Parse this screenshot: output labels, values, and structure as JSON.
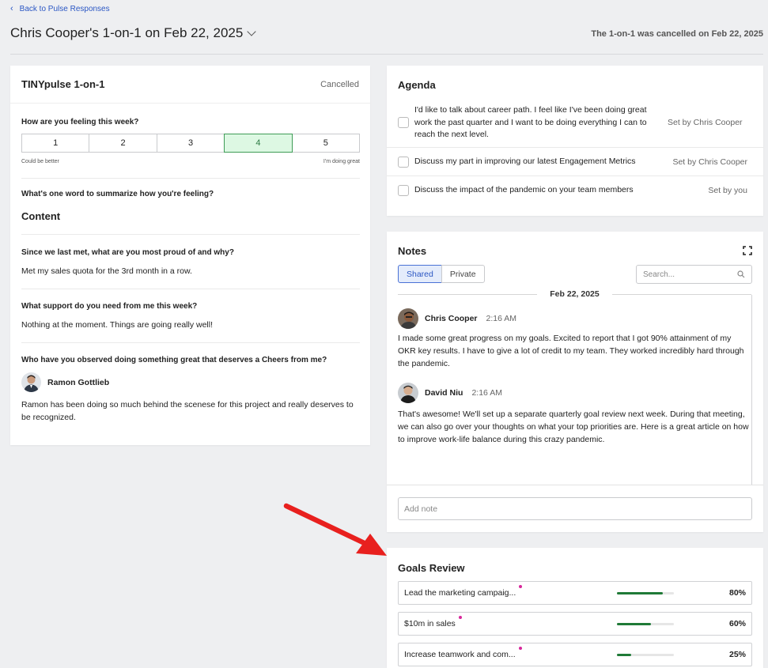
{
  "nav": {
    "back_label": "Back to Pulse Responses"
  },
  "header": {
    "title": "Chris Cooper's 1-on-1 on Feb 22, 2025",
    "cancel_note": "The 1-on-1 was cancelled on Feb 22, 2025"
  },
  "pulse": {
    "title": "TINYpulse 1-on-1",
    "status": "Cancelled",
    "feeling": {
      "question": "How are you feeling this week?",
      "options": [
        "1",
        "2",
        "3",
        "4",
        "5"
      ],
      "selected_value": "4",
      "low_caption": "Could be better",
      "high_caption": "I'm doing great"
    },
    "word": {
      "question": "What's one word to summarize how you're feeling?",
      "answer": "Content"
    },
    "proud": {
      "question": "Since we last met, what are you most proud of and why?",
      "answer": "Met my sales quota for the 3rd month in a row."
    },
    "support": {
      "question": "What support do you need from me this week?",
      "answer": "Nothing at the moment. Things are going really well!"
    },
    "cheers": {
      "question": "Who have you observed doing something great that deserves a Cheers from me?",
      "person": "Ramon Gottlieb",
      "answer": "Ramon has been doing so much behind the scenese for this project and really deserves to be recognized."
    }
  },
  "agenda": {
    "title": "Agenda",
    "items": [
      {
        "text": "I'd like to talk about career path. I feel like I've been doing great work the past quarter and I want to be doing everything I can to reach the next level.",
        "set_by": "Set by Chris Cooper"
      },
      {
        "text": "Discuss my part in improving our latest Engagement Metrics",
        "set_by": "Set by Chris Cooper"
      },
      {
        "text": "Discuss the impact of the pandemic on your team members",
        "set_by": "Set by you"
      }
    ]
  },
  "notes": {
    "title": "Notes",
    "tabs": [
      "Shared",
      "Private"
    ],
    "active_tab": "Shared",
    "search_placeholder": "Search...",
    "date": "Feb 22, 2025",
    "entries": [
      {
        "author": "Chris Cooper",
        "time": "2:16 AM",
        "body": "I made some great progress on my goals. Excited to report that I got 90% attainment of my OKR key results. I have to give a lot of credit to my team. They worked incredibly hard through the pandemic."
      },
      {
        "author": "David Niu",
        "time": "2:16 AM",
        "body": "That's awesome! We'll set up a separate quarterly goal review next week. During that meeting, we can also go over your thoughts on what your top priorities are. Here is a great article on how to improve work-life balance during this crazy pandemic."
      }
    ],
    "add_placeholder": "Add note"
  },
  "goals": {
    "title": "Goals Review",
    "items": [
      {
        "name": "Lead the marketing campaig...",
        "progress": 0.8,
        "percent_label": "80%"
      },
      {
        "name": "$10m in sales",
        "progress": 0.6,
        "percent_label": "60%"
      },
      {
        "name": "Increase teamwork and com...",
        "progress": 0.25,
        "percent_label": "25%"
      }
    ]
  },
  "colors": {
    "link": "#2b57c4",
    "selected_bg": "#ddf8e3",
    "progress_fill": "#1f7a37",
    "goal_dot": "#d8279b",
    "annotation_arrow": "#e8201e"
  },
  "icons": {
    "back": "chevron-left-icon",
    "title_menu": "chevron-down-icon",
    "expand": "expand-icon",
    "search": "search-icon",
    "annotation": "red-arrow-icon"
  }
}
